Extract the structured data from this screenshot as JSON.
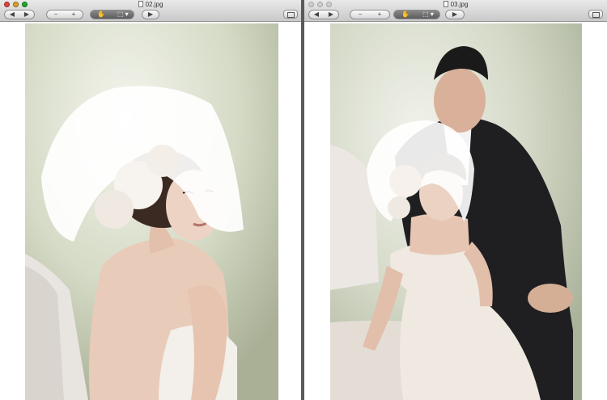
{
  "windows": [
    {
      "title": "02.jpg",
      "toolbar": {
        "nav_prev": "◀",
        "nav_next": "▶",
        "zoom_out": "−",
        "zoom_in": "+",
        "tool_move": "✋",
        "tool_select": "⬚ ▾",
        "slideshow": "▶"
      }
    },
    {
      "title": "03.jpg",
      "toolbar": {
        "nav_prev": "◀",
        "nav_next": "▶",
        "zoom_out": "−",
        "zoom_in": "+",
        "tool_move": "✋",
        "tool_select": "⬚ ▾",
        "slideshow": "▶"
      }
    }
  ],
  "icons": {
    "doc": "document-icon",
    "close": "close-light-icon",
    "minimize": "minimize-light-icon",
    "zoom": "zoom-light-icon",
    "toolbar_toggle": "toolbar-toggle-icon"
  },
  "colors": {
    "light_red": "#e0443e",
    "light_yellow": "#dea123",
    "light_green": "#1aab29"
  }
}
